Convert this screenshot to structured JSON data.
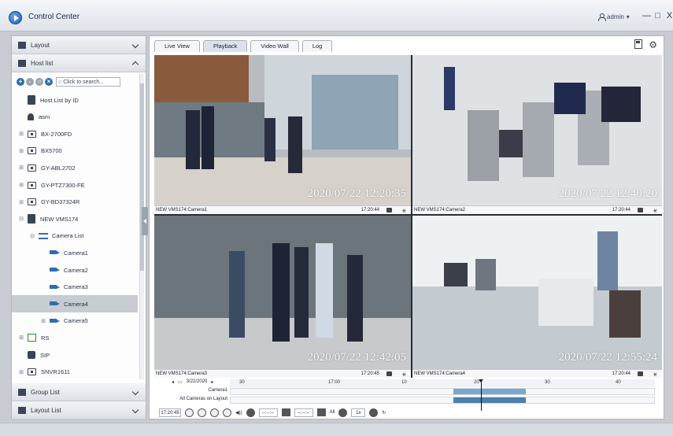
{
  "app": {
    "title": "Control Center",
    "user": "admin",
    "user_caret": "▾",
    "win_min": "—",
    "win_max": "□",
    "win_close": "X"
  },
  "sidebar": {
    "layout_label": "Layout",
    "hostlist_label": "Host list",
    "search_placeholder": "Click to search...",
    "tree": [
      {
        "label": "Host List by ID",
        "icon": "host",
        "indent": 0,
        "expander": ""
      },
      {
        "label": "asm",
        "icon": "user",
        "indent": 0,
        "expander": ""
      },
      {
        "label": "BX-2700FD",
        "icon": "dev",
        "indent": 0,
        "expander": "⊞"
      },
      {
        "label": "BX5700",
        "icon": "dev",
        "indent": 0,
        "expander": "⊞"
      },
      {
        "label": "GY-ABL2702",
        "icon": "dev",
        "indent": 0,
        "expander": "⊞"
      },
      {
        "label": "GY-PTZ7300-FE",
        "icon": "dev",
        "indent": 0,
        "expander": "⊞"
      },
      {
        "label": "GY-BD37324R",
        "icon": "dev",
        "indent": 0,
        "expander": "⊞"
      },
      {
        "label": "NEW VMS174",
        "icon": "host",
        "indent": 0,
        "expander": "⊟"
      },
      {
        "label": "Camera List",
        "icon": "list",
        "indent": 1,
        "expander": "⊟"
      },
      {
        "label": "Camera1",
        "icon": "cam",
        "indent": 2,
        "expander": ""
      },
      {
        "label": "Camera2",
        "icon": "cam",
        "indent": 2,
        "expander": ""
      },
      {
        "label": "Camera3",
        "icon": "cam",
        "indent": 2,
        "expander": ""
      },
      {
        "label": "Camera4",
        "icon": "cam",
        "indent": 2,
        "expander": "",
        "selected": true
      },
      {
        "label": "Camera5",
        "icon": "cam",
        "indent": 2,
        "expander": "⊞"
      },
      {
        "label": "RS",
        "icon": "rs",
        "indent": 0,
        "expander": "⊞"
      },
      {
        "label": "SIP",
        "icon": "sip",
        "indent": 0,
        "expander": ""
      },
      {
        "label": "SNVR1611",
        "icon": "dev",
        "indent": 0,
        "expander": "⊞"
      }
    ],
    "group_list_label": "Group List",
    "layout_list_label": "Layout List"
  },
  "tabs": [
    "Live View",
    "Playback",
    "Video Wall",
    "Log"
  ],
  "active_tab": "Playback",
  "tiles": [
    {
      "name": "NEW VMS174:Camera1",
      "time": "17:20:44",
      "osd": "2020/07/22 12:20:35"
    },
    {
      "name": "NEW VMS174:Camera2",
      "time": "17:20:44",
      "osd": "2020/07/22 12:40:20"
    },
    {
      "name": "NEW VMS174:Camera3",
      "time": "17:20:45",
      "osd": "2020/07/22 12:42:05"
    },
    {
      "name": "NEW VMS174:Camera4",
      "time": "17:20:44",
      "osd": "2020/07/22 12:55:24"
    }
  ],
  "timeline": {
    "date": "3/22/2020",
    "ticks": [
      "30",
      "17:00",
      "10",
      "20",
      "30",
      "40"
    ],
    "row1": "Camera1",
    "row2": "All Cameras on Layout",
    "current_time": "17:20:45",
    "time_a": "--:--:--",
    "time_b": "--:--:--",
    "zoom_label": "All",
    "speed": "1x"
  }
}
